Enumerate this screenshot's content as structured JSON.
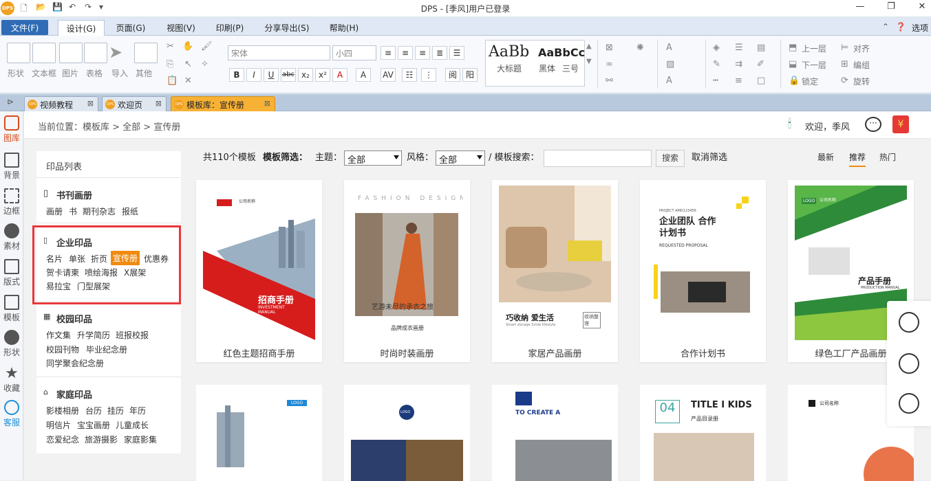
{
  "window": {
    "title": "DPS - [季风]用户已登录",
    "logo": "DPS"
  },
  "menu": {
    "file": "文件(F)",
    "tabs": [
      "设计(G)",
      "页面(G)",
      "视图(V)",
      "印刷(P)",
      "分享导出(S)",
      "帮助(H)"
    ],
    "options": "选项"
  },
  "ribbon": {
    "big_buttons": [
      "形状",
      "文本框",
      "图片",
      "表格",
      "导入",
      "其他"
    ],
    "font_name": "宋体",
    "font_size": "小四",
    "styles": [
      "AaBb",
      "AaBbCc",
      "大标题",
      "黑体",
      "三号"
    ],
    "arrange": [
      "上一层",
      "对齐",
      "下一层",
      "编组",
      "锁定",
      "旋转"
    ]
  },
  "doc_tabs": [
    {
      "label": "视频教程"
    },
    {
      "label": "欢迎页"
    },
    {
      "label": "模板库：宣传册"
    }
  ],
  "left_nav": [
    "图库",
    "背景",
    "边框",
    "素材",
    "版式",
    "模板",
    "形状",
    "收藏",
    "客服"
  ],
  "breadcrumb": "当前位置：模板库 > 全部 > 宣传册",
  "user": {
    "welcome": "欢迎，季风"
  },
  "sidebar": {
    "title": "印品列表",
    "sections": [
      {
        "title": "书刊画册",
        "links": [
          "画册",
          "书",
          "期刊杂志",
          "报纸"
        ]
      },
      {
        "title": "企业印品",
        "links": [
          "名片",
          "单张",
          "折页",
          "宣传册",
          "优惠券",
          "贺卡请柬",
          "喷绘海报",
          "X展架",
          "易拉宝",
          "门型展架"
        ]
      },
      {
        "title": "校园印品",
        "links": [
          "作文集",
          "升学简历",
          "班报校报",
          "校园刊物",
          "毕业纪念册",
          "同学聚会纪念册"
        ]
      },
      {
        "title": "家庭印品",
        "links": [
          "影楼相册",
          "台历",
          "挂历",
          "年历",
          "明信片",
          "宝宝画册",
          "儿童成长",
          "恋爱纪念",
          "旅游摄影",
          "家庭影集"
        ]
      }
    ]
  },
  "filter": {
    "count_text": "共110个模板",
    "filter_label": "模板筛选：",
    "theme_label": "主题：",
    "theme_value": "全部",
    "style_label": "风格：",
    "style_value": "全部",
    "search_label": "/ 模板搜索：",
    "search_button": "搜索",
    "clear": "取消筛选"
  },
  "sort": {
    "latest": "最新",
    "recommended": "推荐",
    "hot": "热门"
  },
  "templates": [
    {
      "title": "红色主题招商手册",
      "cover_text": "招商手册",
      "cover_sub": "INVESTMENT MANUAL",
      "company": "公司名称"
    },
    {
      "title": "时尚时装画册",
      "cover_text": "艺游未尽的承衣之旅",
      "cover_sub": "品牌成衣画册",
      "company": "FASHION DESIGN"
    },
    {
      "title": "家居产品画册",
      "cover_text": "巧收纳 爱生活",
      "cover_sub": "Smart storage  Smile lifestyle",
      "company": "收纳整理"
    },
    {
      "title": "合作计划书",
      "cover_text": "企业团队 合作计划书",
      "cover_sub": "REQUESTED PROPOSAL",
      "company": "PROJECT AMD123456"
    },
    {
      "title": "绿色工厂产品画册",
      "cover_text": "产品手册",
      "cover_sub": "PRODUCTION MANUAL",
      "company": "公司名称"
    }
  ],
  "templates_row2": [
    {
      "cover_text": "LOGO"
    },
    {
      "cover_text": "LOGO"
    },
    {
      "cover_text": "TO CREATE A"
    },
    {
      "cover_text": "TITLE I KIDS",
      "cover_sub": "产品目录册",
      "badge": "04"
    },
    {
      "cover_text": "公司名称"
    }
  ],
  "colors": {
    "accent": "#f08a10",
    "highlight": "#e8373b",
    "file_menu": "#2f6cb5"
  }
}
